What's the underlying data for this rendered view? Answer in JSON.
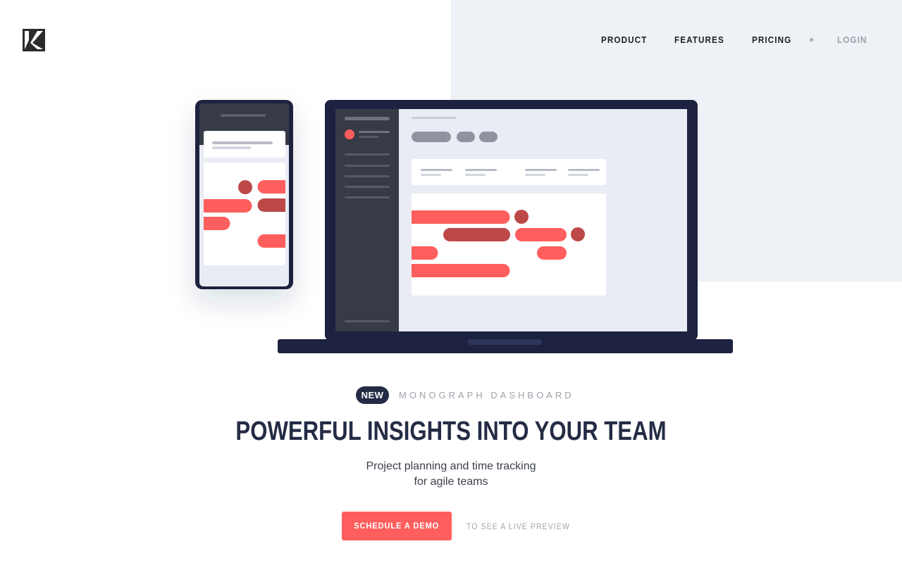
{
  "header": {
    "logo_icon": "monograph-k-logo",
    "nav": [
      {
        "label": "PRODUCT"
      },
      {
        "label": "FEATURES"
      },
      {
        "label": "PRICING"
      }
    ],
    "login_label": "LOGIN"
  },
  "hero": {
    "badge": "NEW",
    "eyebrow": "MONOGRAPH DASHBOARD",
    "headline": "POWERFUL INSIGHTS INTO YOUR TEAM",
    "subtitle_line1": "Project planning and time tracking",
    "subtitle_line2": "for agile teams",
    "cta_label": "SCHEDULE A DEMO",
    "cta_note": "TO SEE A LIVE PREVIEW"
  },
  "colors": {
    "accent": "#ff5e5e",
    "accent_dark": "#bd4848",
    "navy": "#242c45",
    "panel_bg": "#eef1f5"
  }
}
